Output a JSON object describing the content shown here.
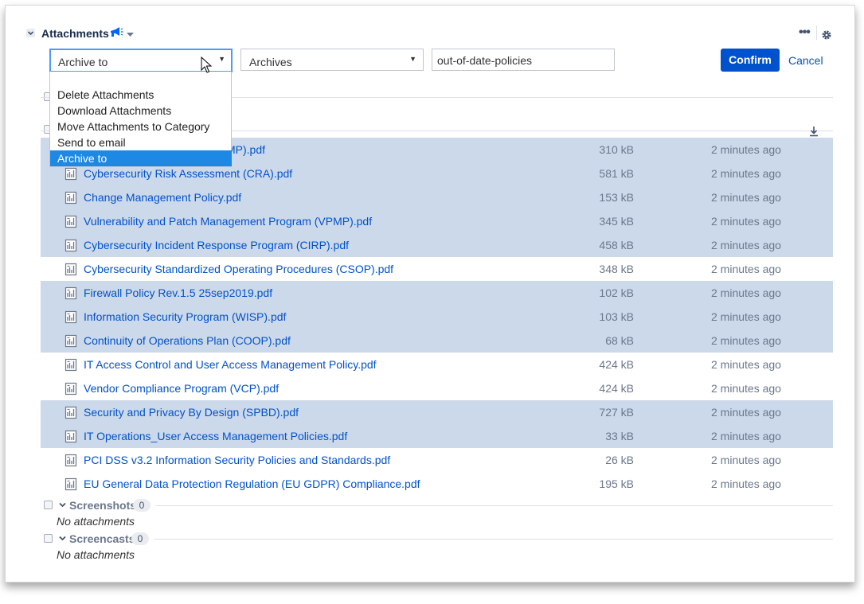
{
  "header": {
    "title": "Attachments",
    "more_label": "•••"
  },
  "toolbar": {
    "action_select": "Archive to",
    "archive_select": "Archives",
    "name_value": "out-of-date-policies",
    "confirm_label": "Confirm",
    "cancel_label": "Cancel",
    "select_arrow": "▼"
  },
  "action_menu": {
    "items": [
      "Delete Attachments",
      "Download Attachments",
      "Move Attachments to Category",
      "Send to email",
      "Archive to"
    ],
    "selected_index": 4
  },
  "files": [
    {
      "name": "Cybersecurity Program Management Program (CPMP).pdf",
      "visible_name_suffix": "MP).pdf",
      "size": "310 kB",
      "time": "2 minutes ago",
      "selected": true
    },
    {
      "name": "Cybersecurity Risk Assessment (CRA).pdf",
      "size": "581 kB",
      "time": "2 minutes ago",
      "selected": true
    },
    {
      "name": "Change Management Policy.pdf",
      "size": "153 kB",
      "time": "2 minutes ago",
      "selected": true
    },
    {
      "name": "Vulnerability and Patch Management Program (VPMP).pdf",
      "size": "345 kB",
      "time": "2 minutes ago",
      "selected": true
    },
    {
      "name": "Cybersecurity Incident Response Program (CIRP).pdf",
      "size": "458 kB",
      "time": "2 minutes ago",
      "selected": true
    },
    {
      "name": "Cybersecurity Standardized Operating Procedures (CSOP).pdf",
      "size": "348 kB",
      "time": "2 minutes ago",
      "selected": false
    },
    {
      "name": "Firewall Policy Rev.1.5 25sep2019.pdf",
      "size": "102 kB",
      "time": "2 minutes ago",
      "selected": true
    },
    {
      "name": "Information Security Program (WISP).pdf",
      "size": "103 kB",
      "time": "2 minutes ago",
      "selected": true
    },
    {
      "name": "Continuity of Operations Plan (COOP).pdf",
      "size": "68 kB",
      "time": "2 minutes ago",
      "selected": true
    },
    {
      "name": "IT Access Control and User Access Management Policy.pdf",
      "size": "424 kB",
      "time": "2 minutes ago",
      "selected": false
    },
    {
      "name": "Vendor Compliance Program (VCP).pdf",
      "size": "424 kB",
      "time": "2 minutes ago",
      "selected": false
    },
    {
      "name": "Security and Privacy By Design (SPBD).pdf",
      "size": "727 kB",
      "time": "2 minutes ago",
      "selected": true
    },
    {
      "name": "IT Operations_User Access Management Policies.pdf",
      "size": "33 kB",
      "time": "2 minutes ago",
      "selected": true
    },
    {
      "name": "PCI DSS v3.2 Information Security Policies and Standards.pdf",
      "size": "26 kB",
      "time": "2 minutes ago",
      "selected": false
    },
    {
      "name": "EU General Data Protection Regulation (EU GDPR) Compliance.pdf",
      "size": "195 kB",
      "time": "2 minutes ago",
      "selected": false
    }
  ],
  "groups": {
    "screenshots": {
      "title": "Screenshots",
      "count": "0",
      "empty_text": "No attachments"
    },
    "screencasts": {
      "title": "Screencasts",
      "count": "0",
      "empty_text": "No attachments"
    }
  },
  "colors": {
    "accent": "#0052cc",
    "row_highlight": "#ccd9ea",
    "menu_selected": "#1e88e5"
  }
}
